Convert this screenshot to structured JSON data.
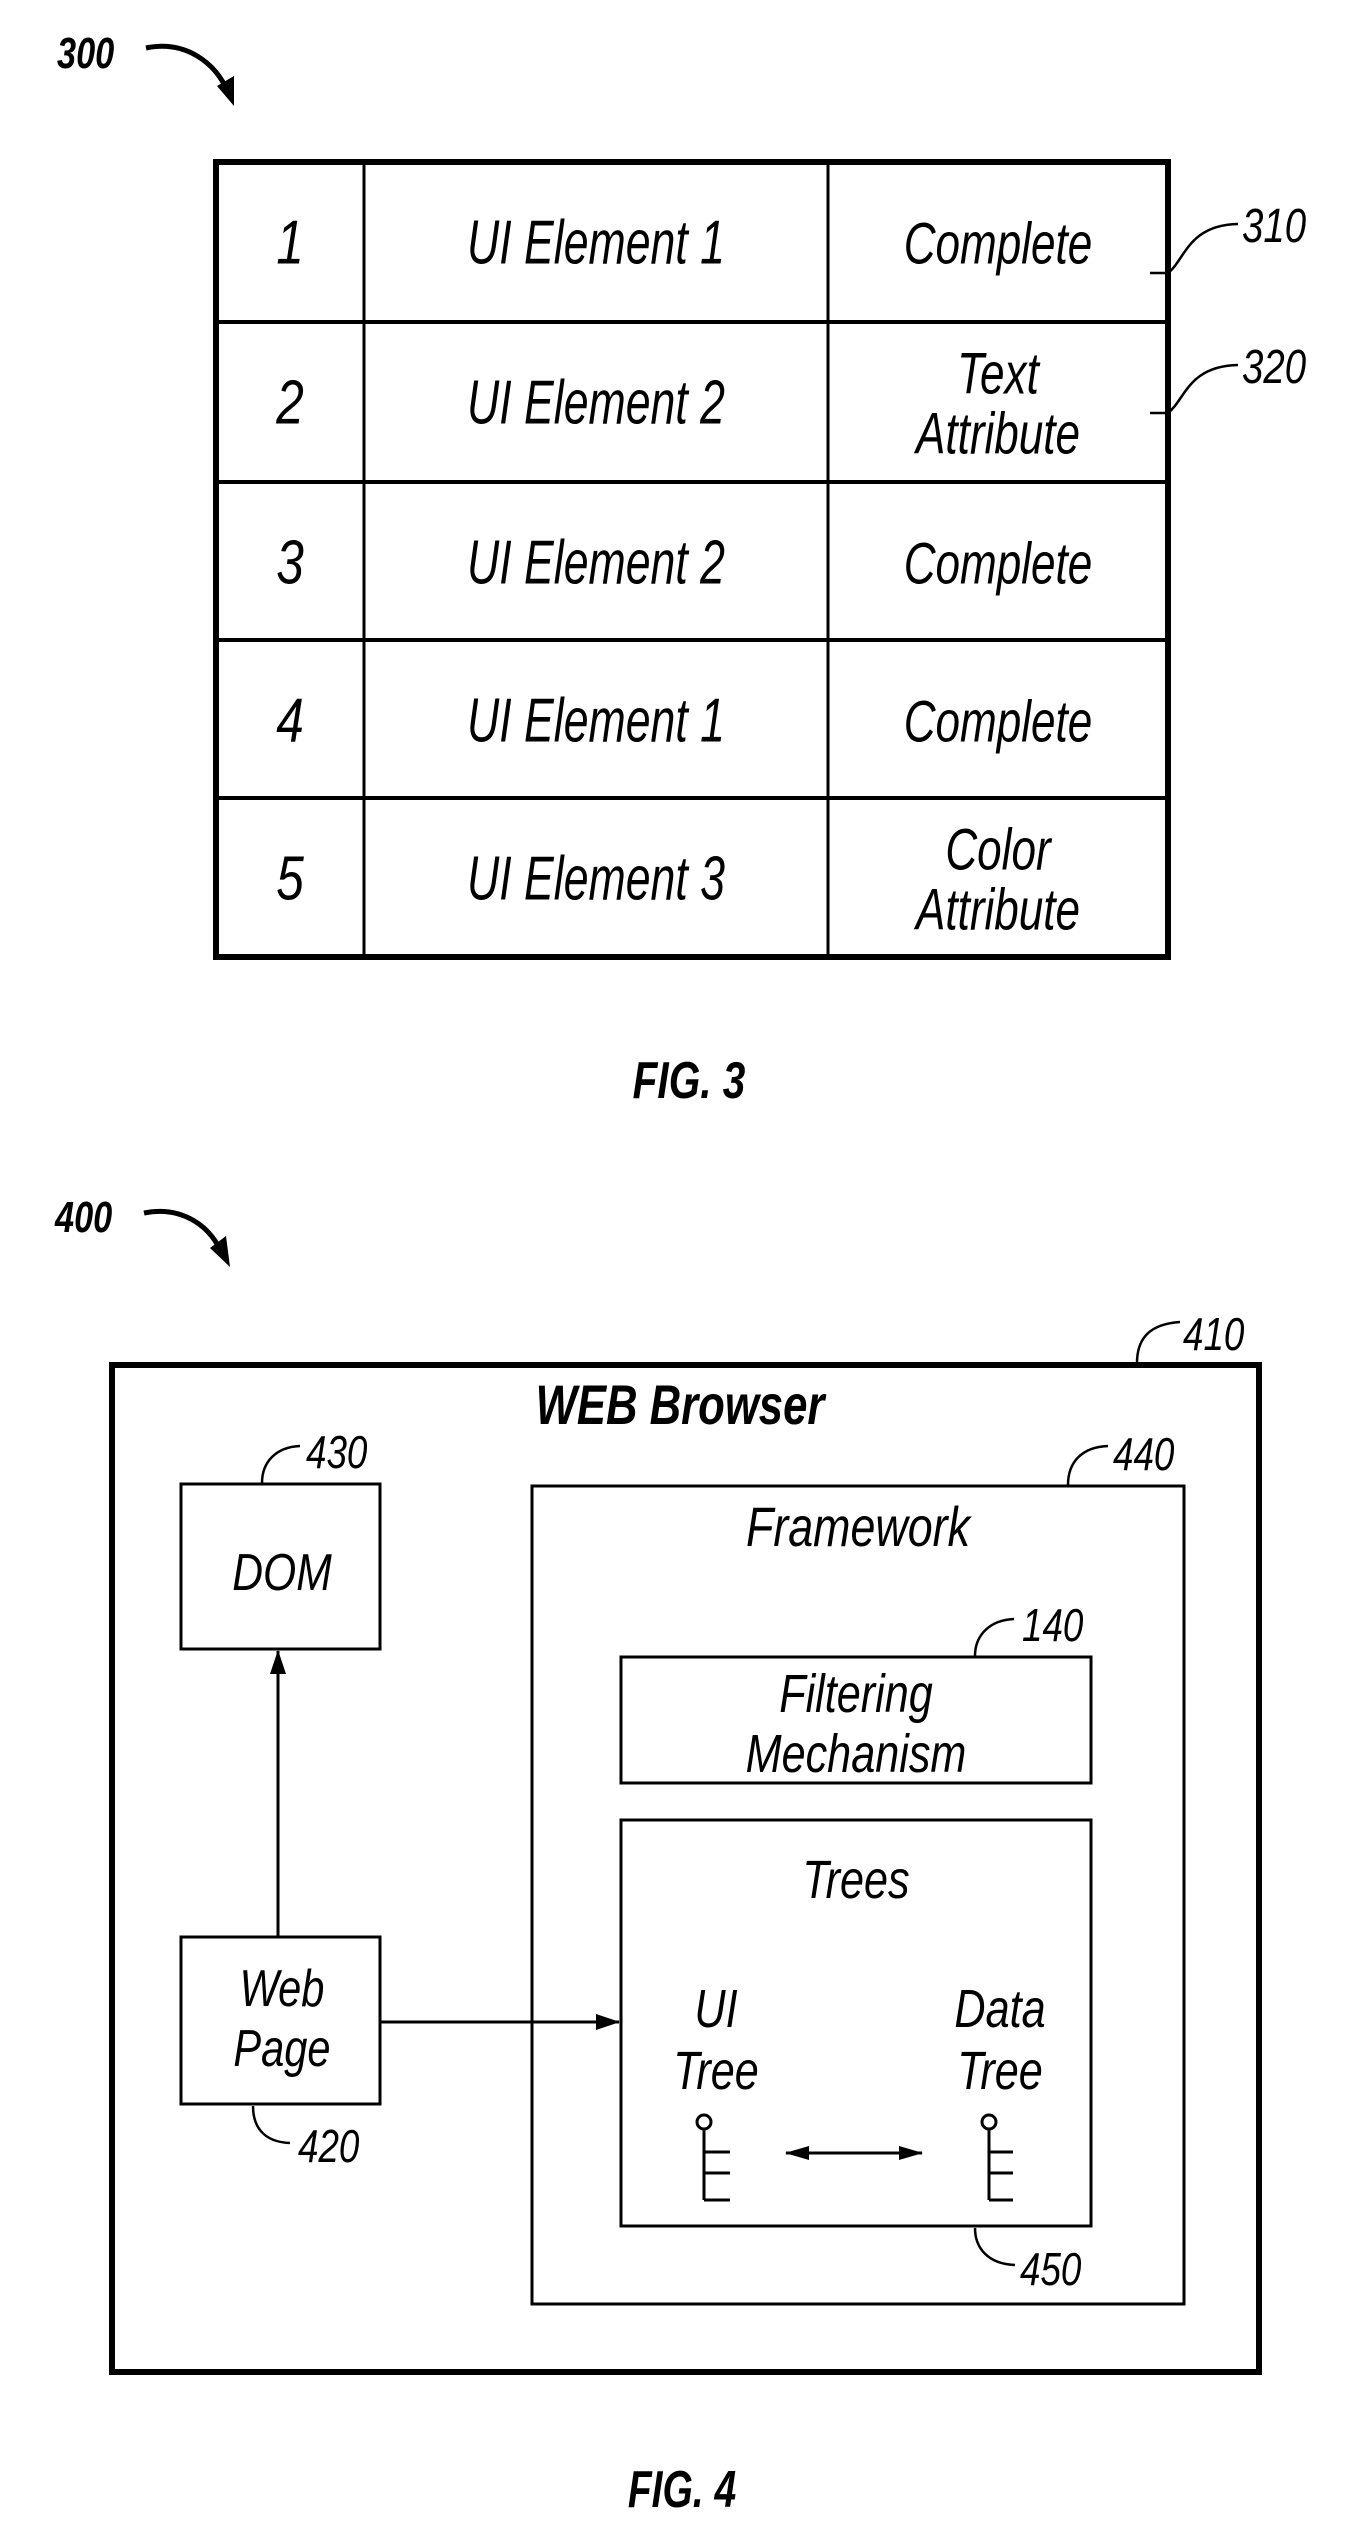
{
  "fig3": {
    "ref_label": "300",
    "caption": "FIG. 3",
    "callouts": [
      {
        "label": "310",
        "row": 0
      },
      {
        "label": "320",
        "row": 1
      }
    ],
    "rows": [
      {
        "index": "1",
        "element": "UI Element 1",
        "status": [
          "Complete"
        ]
      },
      {
        "index": "2",
        "element": "UI Element 2",
        "status": [
          "Text",
          "Attribute"
        ]
      },
      {
        "index": "3",
        "element": "UI Element 2",
        "status": [
          "Complete"
        ]
      },
      {
        "index": "4",
        "element": "UI Element 1",
        "status": [
          "Complete"
        ]
      },
      {
        "index": "5",
        "element": "UI Element 3",
        "status": [
          "Color",
          "Attribute"
        ]
      }
    ]
  },
  "fig4": {
    "ref_label": "400",
    "caption": "FIG. 4",
    "browser": {
      "title": "WEB Browser",
      "ref": "410"
    },
    "dom": {
      "label": "DOM",
      "ref": "430"
    },
    "web_page": {
      "label": [
        "Web",
        "Page"
      ],
      "ref": "420"
    },
    "framework": {
      "label": "Framework",
      "ref": "440"
    },
    "filtering": {
      "label": [
        "Filtering",
        "Mechanism"
      ],
      "ref": "140"
    },
    "trees": {
      "label": "Trees",
      "ref": "450",
      "ui_tree": [
        "UI",
        "Tree"
      ],
      "data_tree": [
        "Data",
        "Tree"
      ]
    }
  }
}
